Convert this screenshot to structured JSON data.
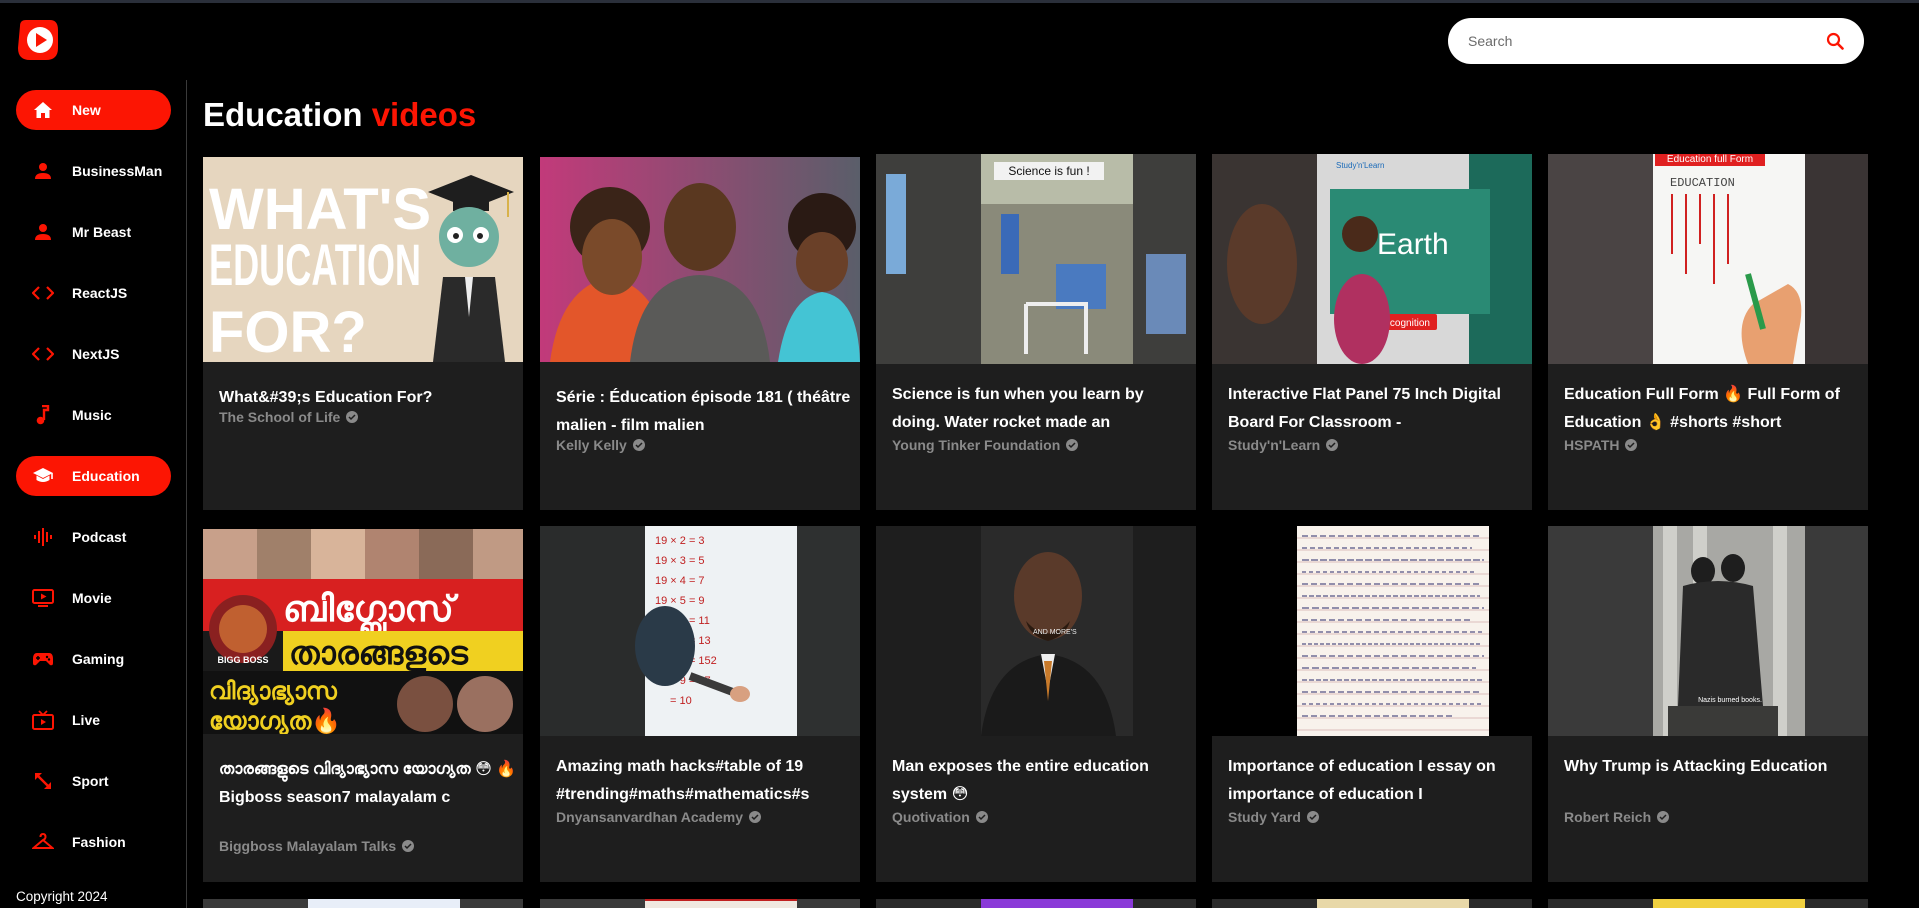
{
  "search": {
    "placeholder": "Search"
  },
  "sidebar": {
    "items": [
      {
        "label": "New",
        "icon": "home-icon",
        "active": false
      },
      {
        "label": "BusinessMan",
        "icon": "person-icon"
      },
      {
        "label": "Mr Beast",
        "icon": "person-icon"
      },
      {
        "label": "ReactJS",
        "icon": "code-icon"
      },
      {
        "label": "NextJS",
        "icon": "code-icon"
      },
      {
        "label": "Music",
        "icon": "music-note-icon"
      },
      {
        "label": "Education",
        "icon": "school-icon",
        "active": true
      },
      {
        "label": "Podcast",
        "icon": "graphic-eq-icon"
      },
      {
        "label": "Movie",
        "icon": "ondemand-video-icon"
      },
      {
        "label": "Gaming",
        "icon": "gamepad-icon"
      },
      {
        "label": "Live",
        "icon": "live-tv-icon"
      },
      {
        "label": "Sport",
        "icon": "sport-arrows-icon"
      },
      {
        "label": "Fashion",
        "icon": "hanger-icon"
      }
    ],
    "copyright": "Copyright 2024"
  },
  "page": {
    "title_main": "Education",
    "title_accent": "videos"
  },
  "videos": [
    {
      "title": "What&#39;s Education For?",
      "channel": "The School of Life"
    },
    {
      "title": "Série : Éducation épisode 181 ( théâtre malien - film malien",
      "channel": "Kelly Kelly"
    },
    {
      "title": "Science is fun when you learn by doing. Water rocket made an",
      "channel": "Young Tinker Foundation"
    },
    {
      "title": "Interactive Flat Panel 75 Inch Digital Board For Classroom -",
      "channel": "Study'n'Learn"
    },
    {
      "title": "Education Full Form 🔥 Full Form of Education 👌 #shorts #short",
      "channel": "HSPATH"
    },
    {
      "title": "താരങ്ങളുടെ വിദ്യാഭ്യാസ യോഗ്യത 😳 🔥 Bigboss season7 malayalam c",
      "channel": "Biggboss Malayalam Talks"
    },
    {
      "title": "Amazing math hacks#table of 19 #trending#maths#mathematics#s",
      "channel": "Dnyansanvardhan Academy"
    },
    {
      "title": "Man exposes the entire education system 😳",
      "channel": "Quotivation"
    },
    {
      "title": "Importance of education I essay on importance of education I",
      "channel": "Study Yard"
    },
    {
      "title": "Why Trump is Attacking Education",
      "channel": "Robert Reich"
    }
  ],
  "thumbnails": [
    {
      "text_lines": [
        "WHAT'S",
        "EDUCATION",
        "FOR?"
      ]
    },
    {
      "text_lines": []
    },
    {
      "text_lines": [
        "Science is fun !"
      ]
    },
    {
      "text_lines": [
        "Earth",
        "Text Recognition",
        "Study'n'Learn"
      ]
    },
    {
      "text_lines": [
        "Education full Form",
        "EDUCATION"
      ]
    },
    {
      "text_lines": [
        "ബിഗ്ബോസ്",
        "താരങ്ങളുടെ",
        "വിദ്യാഭ്യാസ",
        "യോഗ്യത🔥",
        "BIGG BOSS"
      ]
    },
    {
      "text_lines": [
        "19 × 2 = 3",
        "19 × 3 = 5",
        "19 × 4 = 7",
        "19 × 5 = 9",
        "19 × 6 = 11",
        "19 × 7 = 13",
        "19 × 8 = 152",
        "19 × 9 = 17",
        "= 10"
      ]
    },
    {
      "text_lines": [
        "AND MORE'S"
      ]
    },
    {
      "text_lines": []
    },
    {
      "text_lines": [
        "Nazis burned books."
      ]
    }
  ],
  "colors": {
    "accent": "#fc1503",
    "card_bg": "#1e1e1e",
    "channel_text": "#8a8a8a"
  }
}
